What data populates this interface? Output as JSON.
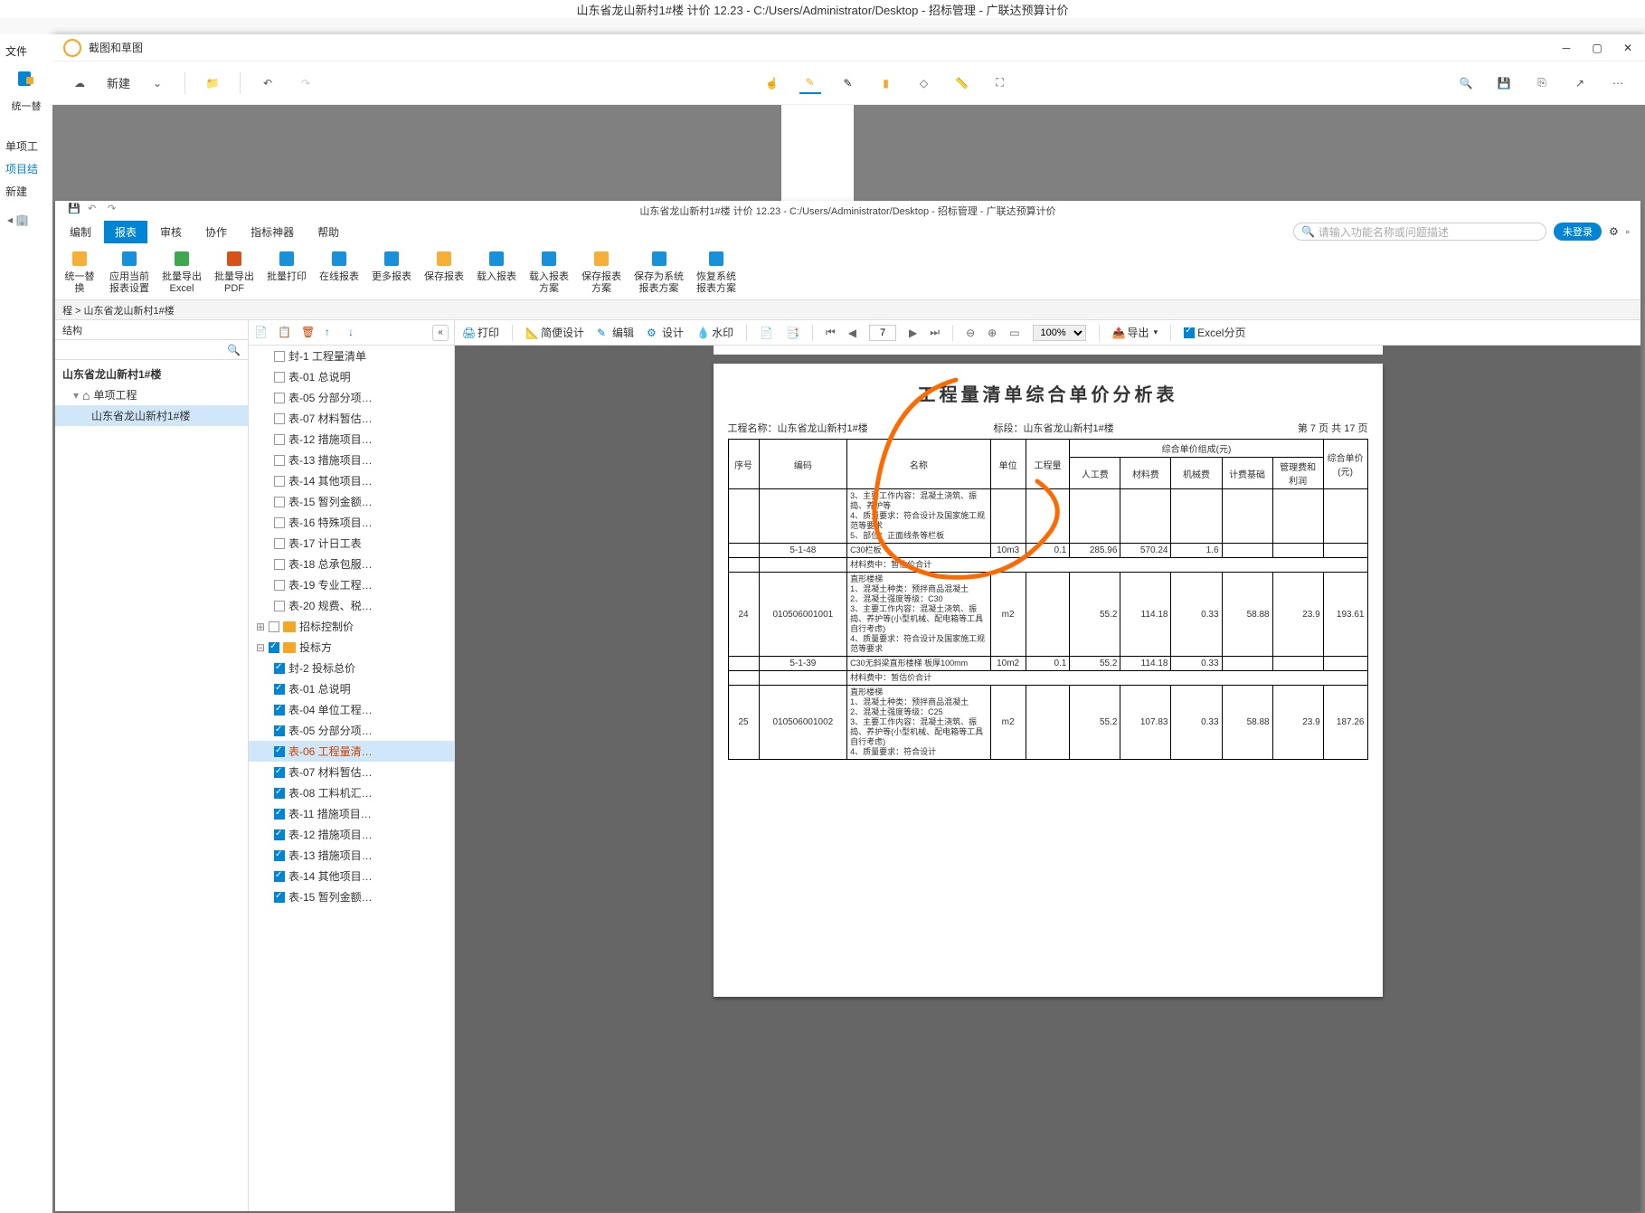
{
  "parent_title": "山东省龙山新村1#楼  计价 12.23 - C:/Users/Administrator/Desktop - 招标管理 - 广联达预算计价",
  "left_strip": {
    "file": "文件",
    "unify": "统一替",
    "single": "单项工",
    "project": "项目结",
    "new": "新建"
  },
  "snip": {
    "title": "截图和草图",
    "new": "新建"
  },
  "inner_title": "山东省龙山新村1#楼  计价 12.23 - C:/Users/Administrator/Desktop - 招标管理 - 广联达预算计价",
  "menu": {
    "compile": "编制",
    "report": "报表",
    "review": "审核",
    "collab": "协作",
    "index": "指标神器",
    "help": "帮助",
    "search_ph": "请输入功能名称或问题描述",
    "login": "未登录"
  },
  "ribbon": [
    {
      "l1": "统一替",
      "l2": "换",
      "c": "#f5a623"
    },
    {
      "l1": "应用当前",
      "l2": "报表设置"
    },
    {
      "l1": "批量导出",
      "l2": "Excel"
    },
    {
      "l1": "批量导出",
      "l2": "PDF"
    },
    {
      "l1": "批量打印",
      "l2": ""
    },
    {
      "l1": "在线报表",
      "l2": ""
    },
    {
      "l1": "更多报表",
      "l2": ""
    },
    {
      "l1": "保存报表",
      "l2": ""
    },
    {
      "l1": "载入报表",
      "l2": ""
    },
    {
      "l1": "载入报表",
      "l2": "方案"
    },
    {
      "l1": "保存报表",
      "l2": "方案"
    },
    {
      "l1": "保存为系统",
      "l2": "报表方案"
    },
    {
      "l1": "恢复系统",
      "l2": "报表方案"
    }
  ],
  "breadcrumb": "程 > 山东省龙山新村1#楼",
  "left_tree": {
    "tab": "结构",
    "root": "山东省龙山新村1#楼",
    "sub": "单项工程",
    "leaf": "山东省龙山新村1#楼"
  },
  "report_tree": [
    {
      "t": "封-1 工程量清单",
      "c": false,
      "lv": 2
    },
    {
      "t": "表-01 总说明",
      "c": false,
      "lv": 2
    },
    {
      "t": "表-05 分部分项…",
      "c": false,
      "lv": 2
    },
    {
      "t": "表-07 材料暂估…",
      "c": false,
      "lv": 2
    },
    {
      "t": "表-12 措施项目…",
      "c": false,
      "lv": 2
    },
    {
      "t": "表-13 措施项目…",
      "c": false,
      "lv": 2
    },
    {
      "t": "表-14 其他项目…",
      "c": false,
      "lv": 2
    },
    {
      "t": "表-15 暂列金额…",
      "c": false,
      "lv": 2
    },
    {
      "t": "表-16 特殊项目…",
      "c": false,
      "lv": 2
    },
    {
      "t": "表-17 计日工表",
      "c": false,
      "lv": 2
    },
    {
      "t": "表-18 总承包服…",
      "c": false,
      "lv": 2
    },
    {
      "t": "表-19 专业工程…",
      "c": false,
      "lv": 2
    },
    {
      "t": "表-20 规费、税…",
      "c": false,
      "lv": 2
    },
    {
      "t": "招标控制价",
      "c": false,
      "lv": 1,
      "folder": true
    },
    {
      "t": "投标方",
      "c": true,
      "lv": 1,
      "folder": true
    },
    {
      "t": "封-2 投标总价",
      "c": true,
      "lv": 2
    },
    {
      "t": "表-01 总说明",
      "c": true,
      "lv": 2
    },
    {
      "t": "表-04 单位工程…",
      "c": true,
      "lv": 2
    },
    {
      "t": "表-05 分部分项…",
      "c": true,
      "lv": 2
    },
    {
      "t": "表-06 工程量清…",
      "c": true,
      "lv": 2,
      "sel": true
    },
    {
      "t": "表-07 材料暂估…",
      "c": true,
      "lv": 2
    },
    {
      "t": "表-08 工料机汇…",
      "c": true,
      "lv": 2
    },
    {
      "t": "表-11 措施项目…",
      "c": true,
      "lv": 2
    },
    {
      "t": "表-12 措施项目…",
      "c": true,
      "lv": 2
    },
    {
      "t": "表-13 措施项目…",
      "c": true,
      "lv": 2
    },
    {
      "t": "表-14 其他项目…",
      "c": true,
      "lv": 2
    },
    {
      "t": "表-15 暂列金额…",
      "c": true,
      "lv": 2
    }
  ],
  "preview_tb": {
    "print": "打印",
    "simple": "简便设计",
    "edit": "编辑",
    "design": "设计",
    "watermark": "水印",
    "page": "7",
    "zoom": "100%",
    "export": "导出",
    "excel": "Excel分页"
  },
  "doc": {
    "title": "工程量清单综合单价分析表",
    "proj_lbl": "工程名称：",
    "proj": "山东省龙山新村1#楼",
    "sec_lbl": "标段：",
    "sec": "山东省龙山新村1#楼",
    "pager": "第 7 页  共 17 页",
    "th": {
      "seq": "序号",
      "code": "编码",
      "name": "名称",
      "unit": "单位",
      "qty": "工程量",
      "gp": "综合单价组成(元)",
      "lab": "人工费",
      "mat": "材料费",
      "mach": "机械费",
      "base": "计费基础",
      "mgmt": "管理费和利润",
      "price": "综合单价(元)"
    },
    "rows": [
      {
        "seq": "",
        "code": "",
        "name": "3、主要工作内容：混凝土浇筑、振捣、养护等\\n4、质量要求：符合设计及国家施工规范等要求\\n5、部位：正面线条等栏板",
        "unit": "",
        "qty": "",
        "lab": "",
        "mat": "",
        "mach": "",
        "base": "",
        "mgmt": "",
        "price": ""
      },
      {
        "seq": "",
        "code": "5-1-48",
        "name": "C30栏板",
        "unit": "10m3",
        "qty": "0.1",
        "lab": "285.96",
        "mat": "570.24",
        "mach": "1.6",
        "base": "",
        "mgmt": "",
        "price": ""
      },
      {
        "seq": "",
        "code": "",
        "name": "材料费中：暂估价合计",
        "span": true
      },
      {
        "seq": "24",
        "code": "010506001001",
        "name": "直形楼梯\\n1、混凝土种类：预拌商品混凝土\\n2、混凝土强度等级：C30\\n3、主要工作内容：混凝土浇筑、振捣、养护等(小型机械、配电箱等工具自行考虑)\\n4、质量要求：符合设计及国家施工规范等要求",
        "unit": "m2",
        "qty": "",
        "lab": "55.2",
        "mat": "114.18",
        "mach": "0.33",
        "base": "58.88",
        "mgmt": "23.9",
        "price": "193.61"
      },
      {
        "seq": "",
        "code": "5-1-39",
        "name": "C30无斜梁直形楼梯 板厚100mm",
        "unit": "10m2",
        "qty": "0.1",
        "lab": "55.2",
        "mat": "114.18",
        "mach": "0.33",
        "base": "",
        "mgmt": "",
        "price": ""
      },
      {
        "seq": "",
        "code": "",
        "name": "材料费中：暂估价合计",
        "span": true
      },
      {
        "seq": "25",
        "code": "010506001002",
        "name": "直形楼梯\\n1、混凝土种类：预拌商品混凝土\\n2、混凝土强度等级：C25\\n3、主要工作内容：混凝土浇筑、振捣、养护等(小型机械、配电箱等工具自行考虑)\\n4、质量要求：符合设计",
        "unit": "m2",
        "qty": "",
        "lab": "55.2",
        "mat": "107.83",
        "mach": "0.33",
        "base": "58.88",
        "mgmt": "23.9",
        "price": "187.26"
      }
    ]
  }
}
